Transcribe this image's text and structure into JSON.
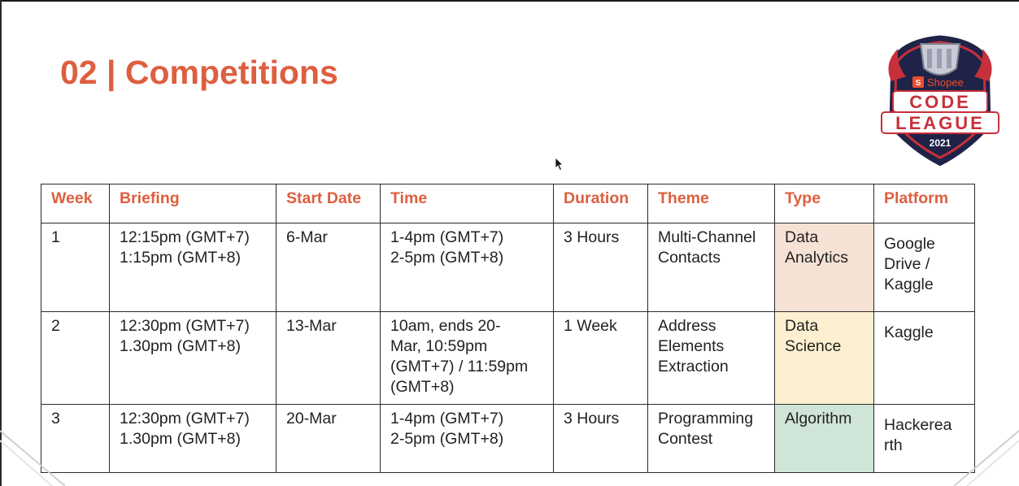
{
  "title": "02 | Competitions",
  "logo": {
    "brand_text": "Shopee",
    "line1": "CODE",
    "line2": "LEAGUE",
    "year": "2021"
  },
  "table": {
    "headers": [
      "Week",
      "Briefing",
      "Start Date",
      "Time",
      "Duration",
      "Theme",
      "Type",
      "Platform"
    ],
    "rows": [
      {
        "week": "1",
        "briefing": [
          "12:15pm (GMT+7)",
          "1:15pm (GMT+8)"
        ],
        "start_date": "6-Mar",
        "time": [
          "1-4pm (GMT+7)",
          "2-5pm (GMT+8)"
        ],
        "duration": "3 Hours",
        "theme": [
          "Multi-Channel",
          "Contacts"
        ],
        "type": [
          "Data",
          "Analytics"
        ],
        "platform": [
          "Google",
          "Drive /",
          "Kaggle"
        ]
      },
      {
        "week": "2",
        "briefing": [
          "12:30pm (GMT+7)",
          "1.30pm (GMT+8)"
        ],
        "start_date": "13-Mar",
        "time": [
          "10am, ends 20-",
          "Mar, 10:59pm",
          "(GMT+7) / 11:59pm",
          "(GMT+8)"
        ],
        "duration": "1 Week",
        "theme": [
          "Address",
          "Elements",
          "Extraction"
        ],
        "type": [
          "Data",
          "Science"
        ],
        "platform": [
          "Kaggle"
        ]
      },
      {
        "week": "3",
        "briefing": [
          "12:30pm (GMT+7)",
          "1.30pm (GMT+8)"
        ],
        "start_date": "20-Mar",
        "time": [
          "1-4pm (GMT+7)",
          "2-5pm (GMT+8)"
        ],
        "duration": "3 Hours",
        "theme": [
          "Programming",
          "Contest"
        ],
        "type": [
          "Algorithm"
        ],
        "platform": [
          "Hackerea",
          "rth"
        ]
      }
    ]
  },
  "colors": {
    "title": "#dd5f3f",
    "header_text": "#dd5f3f",
    "type_row1_bg": "#f6e2d4",
    "type_row2_bg": "#fcf0d0",
    "type_row3_bg": "#cfe5d8"
  }
}
